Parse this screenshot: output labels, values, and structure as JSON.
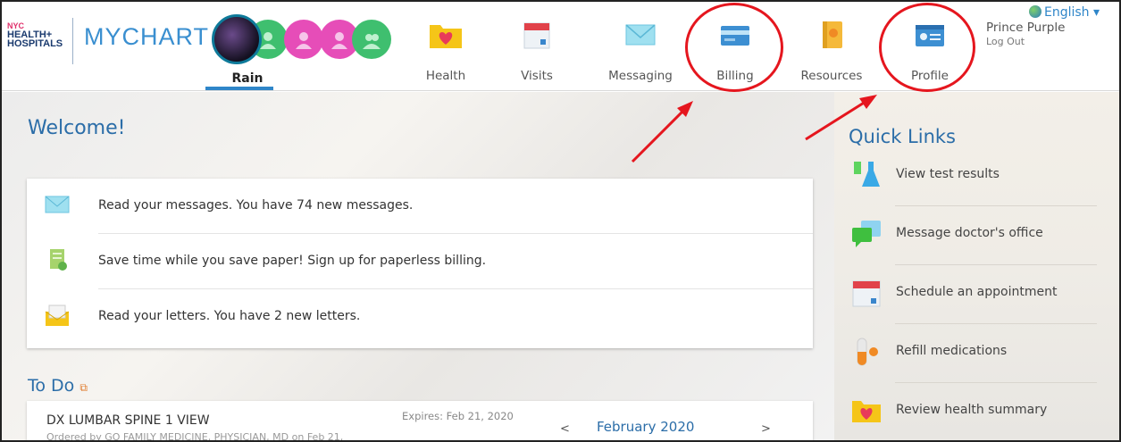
{
  "header": {
    "logo_top": "NYC",
    "logo_line1": "HEALTH+",
    "logo_line2": "HOSPITALS",
    "app_title": "MYCHART",
    "active_profile": "Rain",
    "nav": [
      {
        "label": "Health",
        "icon": "heart-folder-icon"
      },
      {
        "label": "Visits",
        "icon": "calendar-icon"
      },
      {
        "label": "Messaging",
        "icon": "envelope-icon"
      },
      {
        "label": "Billing",
        "icon": "credit-card-icon"
      },
      {
        "label": "Resources",
        "icon": "book-icon"
      },
      {
        "label": "Profile",
        "icon": "id-card-icon"
      }
    ],
    "language": "English",
    "user_name": "Prince Purple",
    "logout": "Log Out"
  },
  "main": {
    "welcome": "Welcome!",
    "messages": [
      {
        "text": "Read your messages. You have 74 new messages.",
        "icon": "envelope-icon"
      },
      {
        "text": "Save time while you save paper! Sign up for paperless billing.",
        "icon": "paper-bill-icon"
      },
      {
        "text": "Read your letters. You have 2 new letters.",
        "icon": "letter-icon"
      }
    ],
    "todo": {
      "title": "To Do",
      "item_name": "DX LUMBAR SPINE 1 VIEW",
      "item_sub": "Ordered by GO FAMILY MEDICINE, PHYSICIAN, MD on Feb 21,",
      "expires": "Expires: Feb 21, 2020",
      "prev": "<",
      "month": "February 2020",
      "next": ">"
    }
  },
  "sidebar": {
    "title": "Quick Links",
    "links": [
      {
        "label": "View test results",
        "icon": "test-tube-icon"
      },
      {
        "label": "Message doctor's office",
        "icon": "chat-bubbles-icon"
      },
      {
        "label": "Schedule an appointment",
        "icon": "calendar-icon"
      },
      {
        "label": "Refill medications",
        "icon": "pill-icon"
      },
      {
        "label": "Review health summary",
        "icon": "heart-folder-icon"
      }
    ]
  },
  "colors": {
    "accent": "#2b6da8",
    "highlight": "#e5161e"
  }
}
